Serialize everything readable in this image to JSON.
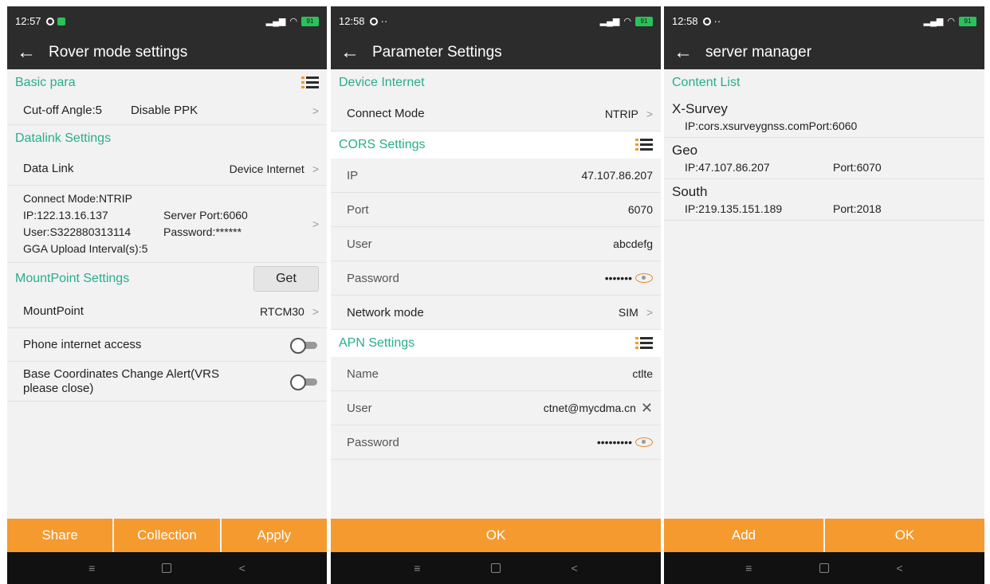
{
  "panel1": {
    "status": {
      "time": "12:57",
      "battery": "91"
    },
    "title": "Rover mode settings",
    "basic_para": "Basic para",
    "cutoff": "Cut-off Angle:5",
    "disable_ppk": "Disable PPK",
    "datalink_settings": "Datalink Settings",
    "data_link_label": "Data Link",
    "data_link_value": "Device Internet",
    "connect_mode": "Connect Mode:NTRIP",
    "ip": "IP:122.13.16.137",
    "server_port": "Server Port:6060",
    "user": "User:S322880313114",
    "password": "Password:******",
    "gga": "GGA Upload Interval(s):5",
    "mountpoint_settings": "MountPoint Settings",
    "get": "Get",
    "mountpoint_label": "MountPoint",
    "mountpoint_value": "RTCM30",
    "phone_internet": "Phone internet access",
    "base_alert": "Base Coordinates Change Alert(VRS please close)",
    "buttons": [
      "Share",
      "Collection",
      "Apply"
    ]
  },
  "panel2": {
    "status": {
      "time": "12:58",
      "battery": "91"
    },
    "title": "Parameter Settings",
    "device_internet": "Device Internet",
    "connect_mode_label": "Connect Mode",
    "connect_mode_value": "NTRIP",
    "cors_settings": "CORS Settings",
    "ip_label": "IP",
    "ip_value": "47.107.86.207",
    "port_label": "Port",
    "port_value": "6070",
    "user_label": "User",
    "user_value": "abcdefg",
    "password_label": "Password",
    "password_value": "•••••••",
    "network_mode_label": "Network mode",
    "network_mode_value": "SIM",
    "apn_settings": "APN Settings",
    "apn_name_label": "Name",
    "apn_name_value": "ctlte",
    "apn_user_label": "User",
    "apn_user_value": "ctnet@mycdma.cn",
    "apn_password_label": "Password",
    "apn_password_value": "•••••••••",
    "ok": "OK"
  },
  "panel3": {
    "status": {
      "time": "12:58",
      "battery": "91"
    },
    "title": "server manager",
    "content_list": "Content List",
    "servers": [
      {
        "name": "X-Survey",
        "ip": "IP:cors.xsurveygnss.com",
        "port": "Port:6060"
      },
      {
        "name": "Geo",
        "ip": "IP:47.107.86.207",
        "port": "Port:6070"
      },
      {
        "name": "South",
        "ip": "IP:219.135.151.189",
        "port": "Port:2018"
      }
    ],
    "add": "Add",
    "ok": "OK"
  },
  "colors": {
    "accent": "#27ae8a",
    "button": "#f59a2f",
    "bar": "#2c2c2c"
  }
}
